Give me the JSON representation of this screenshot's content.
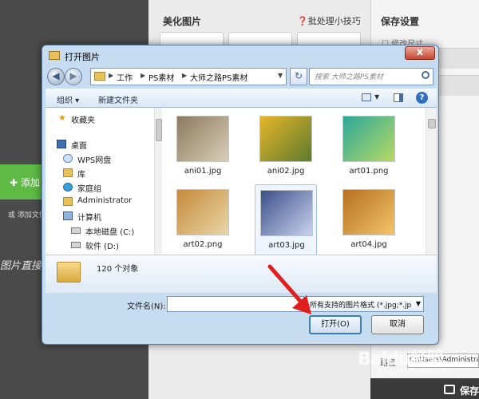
{
  "background_app": {
    "add_button_label": "添加",
    "add_hint": "或 添加文件夹",
    "handwritten_text": "图片直接",
    "beautify_title": "美化图片",
    "batch_tips": "批处理小技巧",
    "save_settings_title": "保存设置",
    "resize_label": "修改尺寸",
    "path_label": "路径",
    "path_value": "C:\\Users\\Administrator",
    "save_button_label": "保存"
  },
  "dialog": {
    "title": "打开图片",
    "close_label": "x",
    "address": {
      "crumbs": [
        "工作",
        "PS素材",
        "大师之路PS素材"
      ]
    },
    "search_placeholder": "搜索 大师之路PS素材",
    "toolbar": {
      "organize_label": "组织 ▾",
      "new_folder_label": "新建文件夹"
    },
    "nav_items": [
      {
        "label": "收藏夹",
        "icon": "star-icon"
      },
      {
        "label": "桌面",
        "icon": "desktop-icon"
      },
      {
        "label": "WPS网盘",
        "icon": "cloud-icon"
      },
      {
        "label": "库",
        "icon": "library-icon"
      },
      {
        "label": "家庭组",
        "icon": "homegroup-icon"
      },
      {
        "label": "Administrator",
        "icon": "user-folder-icon"
      },
      {
        "label": "计算机",
        "icon": "computer-icon"
      },
      {
        "label": "本地磁盘 (C:)",
        "icon": "drive-icon"
      },
      {
        "label": "软件 (D:)",
        "icon": "drive-icon"
      }
    ],
    "files": [
      {
        "name": "ani01.jpg",
        "colors": [
          "#8b7a5e",
          "#d8ceb7"
        ]
      },
      {
        "name": "ani02.jpg",
        "colors": [
          "#e7b52a",
          "#5d7b2f"
        ]
      },
      {
        "name": "art01.png",
        "colors": [
          "#2aa89a",
          "#b9d964"
        ]
      },
      {
        "name": "art02.png",
        "colors": [
          "#c58a3a",
          "#e9d6a8"
        ]
      },
      {
        "name": "art03.jpg",
        "colors": [
          "#3a4e8a",
          "#c9d3ec"
        ]
      },
      {
        "name": "art04.jpg",
        "colors": [
          "#b5701f",
          "#f2c46b"
        ]
      },
      {
        "name": "",
        "colors": [
          "#2a6fd1",
          "#a8d2f5"
        ]
      },
      {
        "name": "",
        "colors": [
          "#1b1b5a",
          "#4b3c9e"
        ]
      }
    ],
    "item_count": "120 个对象",
    "filename_label": "文件名(N):",
    "filename_value": "",
    "filetype_value": "所有支持的图片格式 (*.jpg;*.jp",
    "open_button": "打开(O)",
    "cancel_button": "取消"
  },
  "watermark": {
    "logo": "Baidu经验",
    "url": "jingyan.baidu.com"
  },
  "colors": {
    "accent_green": "#5eb945",
    "annotation_red": "#e01e1e",
    "dialog_frame": "#c6dcf1"
  }
}
